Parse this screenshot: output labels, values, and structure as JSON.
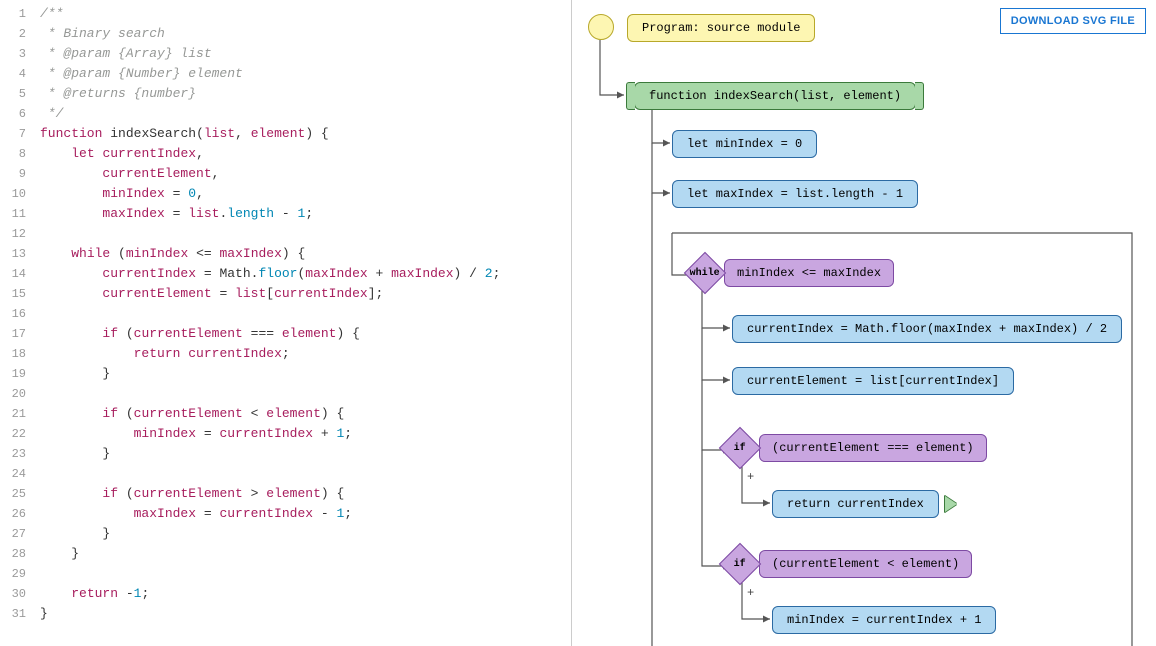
{
  "download_button": "DOWNLOAD SVG FILE",
  "code_lines": [
    [
      {
        "t": "comment",
        "s": "/**"
      }
    ],
    [
      {
        "t": "comment",
        "s": " * Binary search"
      }
    ],
    [
      {
        "t": "comment",
        "s": " * @param {Array} list"
      }
    ],
    [
      {
        "t": "comment",
        "s": " * @param {Number} element"
      }
    ],
    [
      {
        "t": "comment",
        "s": " * @returns {number}"
      }
    ],
    [
      {
        "t": "comment",
        "s": " */"
      }
    ],
    [
      {
        "t": "kw",
        "s": "function"
      },
      {
        "t": "plain",
        "s": " "
      },
      {
        "t": "fn",
        "s": "indexSearch"
      },
      {
        "t": "plain",
        "s": "("
      },
      {
        "t": "id",
        "s": "list"
      },
      {
        "t": "plain",
        "s": ", "
      },
      {
        "t": "id",
        "s": "element"
      },
      {
        "t": "plain",
        "s": ") {"
      }
    ],
    [
      {
        "t": "plain",
        "s": "    "
      },
      {
        "t": "kw",
        "s": "let"
      },
      {
        "t": "plain",
        "s": " "
      },
      {
        "t": "id",
        "s": "currentIndex"
      },
      {
        "t": "plain",
        "s": ","
      }
    ],
    [
      {
        "t": "plain",
        "s": "        "
      },
      {
        "t": "id",
        "s": "currentElement"
      },
      {
        "t": "plain",
        "s": ","
      }
    ],
    [
      {
        "t": "plain",
        "s": "        "
      },
      {
        "t": "id",
        "s": "minIndex"
      },
      {
        "t": "plain",
        "s": " = "
      },
      {
        "t": "num",
        "s": "0"
      },
      {
        "t": "plain",
        "s": ","
      }
    ],
    [
      {
        "t": "plain",
        "s": "        "
      },
      {
        "t": "id",
        "s": "maxIndex"
      },
      {
        "t": "plain",
        "s": " = "
      },
      {
        "t": "id",
        "s": "list"
      },
      {
        "t": "plain",
        "s": "."
      },
      {
        "t": "prop",
        "s": "length"
      },
      {
        "t": "plain",
        "s": " - "
      },
      {
        "t": "num",
        "s": "1"
      },
      {
        "t": "plain",
        "s": ";"
      }
    ],
    [],
    [
      {
        "t": "plain",
        "s": "    "
      },
      {
        "t": "kw",
        "s": "while"
      },
      {
        "t": "plain",
        "s": " ("
      },
      {
        "t": "id",
        "s": "minIndex"
      },
      {
        "t": "plain",
        "s": " <= "
      },
      {
        "t": "id",
        "s": "maxIndex"
      },
      {
        "t": "plain",
        "s": ") {"
      }
    ],
    [
      {
        "t": "plain",
        "s": "        "
      },
      {
        "t": "id",
        "s": "currentIndex"
      },
      {
        "t": "plain",
        "s": " = Math."
      },
      {
        "t": "prop",
        "s": "floor"
      },
      {
        "t": "plain",
        "s": "("
      },
      {
        "t": "id",
        "s": "maxIndex"
      },
      {
        "t": "plain",
        "s": " + "
      },
      {
        "t": "id",
        "s": "maxIndex"
      },
      {
        "t": "plain",
        "s": ") / "
      },
      {
        "t": "num",
        "s": "2"
      },
      {
        "t": "plain",
        "s": ";"
      }
    ],
    [
      {
        "t": "plain",
        "s": "        "
      },
      {
        "t": "id",
        "s": "currentElement"
      },
      {
        "t": "plain",
        "s": " = "
      },
      {
        "t": "id",
        "s": "list"
      },
      {
        "t": "plain",
        "s": "["
      },
      {
        "t": "id",
        "s": "currentIndex"
      },
      {
        "t": "plain",
        "s": "];"
      }
    ],
    [],
    [
      {
        "t": "plain",
        "s": "        "
      },
      {
        "t": "kw",
        "s": "if"
      },
      {
        "t": "plain",
        "s": " ("
      },
      {
        "t": "id",
        "s": "currentElement"
      },
      {
        "t": "plain",
        "s": " === "
      },
      {
        "t": "id",
        "s": "element"
      },
      {
        "t": "plain",
        "s": ") {"
      }
    ],
    [
      {
        "t": "plain",
        "s": "            "
      },
      {
        "t": "kw",
        "s": "return"
      },
      {
        "t": "plain",
        "s": " "
      },
      {
        "t": "id",
        "s": "currentIndex"
      },
      {
        "t": "plain",
        "s": ";"
      }
    ],
    [
      {
        "t": "plain",
        "s": "        }"
      }
    ],
    [],
    [
      {
        "t": "plain",
        "s": "        "
      },
      {
        "t": "kw",
        "s": "if"
      },
      {
        "t": "plain",
        "s": " ("
      },
      {
        "t": "id",
        "s": "currentElement"
      },
      {
        "t": "plain",
        "s": " < "
      },
      {
        "t": "id",
        "s": "element"
      },
      {
        "t": "plain",
        "s": ") {"
      }
    ],
    [
      {
        "t": "plain",
        "s": "            "
      },
      {
        "t": "id",
        "s": "minIndex"
      },
      {
        "t": "plain",
        "s": " = "
      },
      {
        "t": "id",
        "s": "currentIndex"
      },
      {
        "t": "plain",
        "s": " + "
      },
      {
        "t": "num",
        "s": "1"
      },
      {
        "t": "plain",
        "s": ";"
      }
    ],
    [
      {
        "t": "plain",
        "s": "        }"
      }
    ],
    [],
    [
      {
        "t": "plain",
        "s": "        "
      },
      {
        "t": "kw",
        "s": "if"
      },
      {
        "t": "plain",
        "s": " ("
      },
      {
        "t": "id",
        "s": "currentElement"
      },
      {
        "t": "plain",
        "s": " > "
      },
      {
        "t": "id",
        "s": "element"
      },
      {
        "t": "plain",
        "s": ") {"
      }
    ],
    [
      {
        "t": "plain",
        "s": "            "
      },
      {
        "t": "id",
        "s": "maxIndex"
      },
      {
        "t": "plain",
        "s": " = "
      },
      {
        "t": "id",
        "s": "currentIndex"
      },
      {
        "t": "plain",
        "s": " - "
      },
      {
        "t": "num",
        "s": "1"
      },
      {
        "t": "plain",
        "s": ";"
      }
    ],
    [
      {
        "t": "plain",
        "s": "        }"
      }
    ],
    [
      {
        "t": "plain",
        "s": "    }"
      }
    ],
    [],
    [
      {
        "t": "plain",
        "s": "    "
      },
      {
        "t": "kw",
        "s": "return"
      },
      {
        "t": "plain",
        "s": " -"
      },
      {
        "t": "num",
        "s": "1"
      },
      {
        "t": "plain",
        "s": ";"
      }
    ],
    [
      {
        "t": "plain",
        "s": "}"
      }
    ]
  ],
  "flow": {
    "program": "Program: source module",
    "func": "function indexSearch(list, element)",
    "let_min": "let minIndex = 0",
    "let_max": "let maxIndex = list.length - 1",
    "while_kw": "while",
    "while_cond": "minIndex <= maxIndex",
    "stmt_idx": "currentIndex = Math.floor(maxIndex + maxIndex) / 2",
    "stmt_elem": "currentElement = list[currentIndex]",
    "if1_kw": "if",
    "if1_cond": "(currentElement === element)",
    "return1": "return currentIndex",
    "if2_kw": "if",
    "if2_cond": "(currentElement < element)",
    "stmt_min": "minIndex = currentIndex + 1",
    "plus": "+"
  }
}
